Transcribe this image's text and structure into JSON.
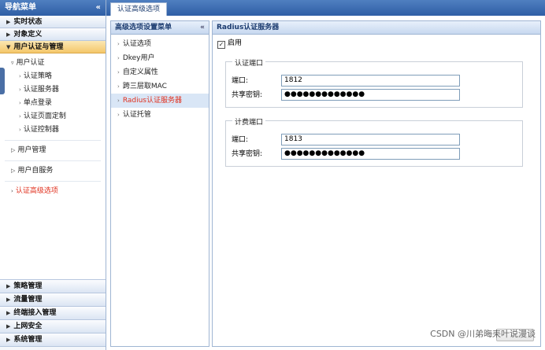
{
  "nav": {
    "title": "导航菜单",
    "collapse": "«",
    "groups_top": [
      "实时状态",
      "对象定义"
    ],
    "active_group": "用户认证与管理",
    "tree": {
      "user_auth": "用户认证",
      "leaves": [
        "认证策略",
        "认证服务器",
        "单点登录",
        "认证页面定制",
        "认证控制器"
      ],
      "user_mgmt": "用户管理",
      "self_service": "用户自服务",
      "advanced": "认证高级选项"
    },
    "groups_bottom": [
      "策略管理",
      "流量管理",
      "终端接入管理",
      "上网安全",
      "系统管理"
    ]
  },
  "tab": {
    "label": "认证高级选项"
  },
  "submenu": {
    "title": "高级选项设置菜单",
    "collapse": "«",
    "items": [
      "认证选项",
      "Dkey用户",
      "自定义属性",
      "跨三层取MAC",
      "Radius认证服务器",
      "认证托管"
    ]
  },
  "content": {
    "title": "Radius认证服务器",
    "enable_label": "启用",
    "enable_check": "✓",
    "auth": {
      "legend": "认证端口",
      "port_label": "端口:",
      "port_value": "1812",
      "secret_label": "共享密钥:",
      "secret_value": "●●●●●●●●●●●●●"
    },
    "acct": {
      "legend": "计费端口",
      "port_label": "端口:",
      "port_value": "1813",
      "secret_label": "共享密钥:",
      "secret_value": "●●●●●●●●●●●●●"
    }
  },
  "watermark": "CSDN @川弟晦耒叶说漫谈"
}
